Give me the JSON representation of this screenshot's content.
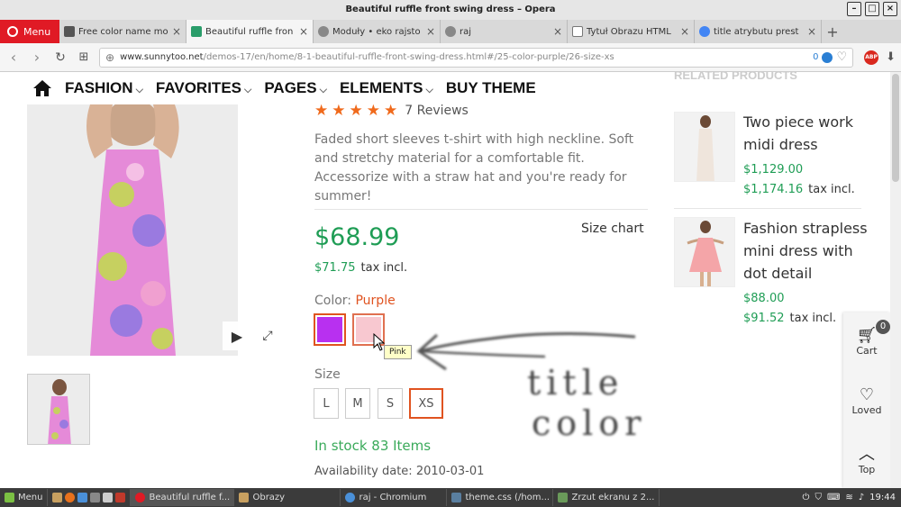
{
  "window": {
    "title": "Beautiful ruffle front swing dress – Opera"
  },
  "browser": {
    "menu_label": "Menu",
    "tabs": [
      {
        "title": "Free color name mo"
      },
      {
        "title": "Beautiful ruffle fron"
      },
      {
        "title": "Moduły • eko rajsto"
      },
      {
        "title": "raj"
      },
      {
        "title": "Tytuł Obrazu HTML"
      },
      {
        "title": "title atrybutu prest"
      }
    ],
    "url_domain": "www.sunnytoo.net",
    "url_path": "/demos-17/en/home/8-1-beautiful-ruffle-front-swing-dress.html#/25-color-purple/26-size-xs",
    "adblock_count": "0",
    "abp_label": "ABP"
  },
  "nav": {
    "items": [
      {
        "label": "FASHION",
        "dropdown": true
      },
      {
        "label": "FAVORITES",
        "dropdown": true
      },
      {
        "label": "PAGES",
        "dropdown": true
      },
      {
        "label": "ELEMENTS",
        "dropdown": true
      },
      {
        "label": "BUY THEME",
        "dropdown": false
      }
    ]
  },
  "product": {
    "rating": 5,
    "reviews": "7 Reviews",
    "description": "Faded short sleeves t-shirt with high neckline. Soft and stretchy material for a comfortable fit. Accessorize with a straw hat and you're ready for summer!",
    "price": "$68.99",
    "price_tax": "$71.75",
    "tax_label": "tax incl.",
    "size_chart": "Size chart",
    "color_label": "Color:",
    "color_value": "Purple",
    "colors": [
      {
        "name": "Purple",
        "hex": "#b830f0"
      },
      {
        "name": "Pink",
        "hex": "#f8c8d0"
      }
    ],
    "tooltip": "Pink",
    "size_label": "Size",
    "sizes": [
      "L",
      "M",
      "S",
      "XS"
    ],
    "selected_size": "XS",
    "stock": "In stock 83 Items",
    "availability": "Availability date: 2010-03-01"
  },
  "related": {
    "heading": "RELATED PRODUCTS",
    "items": [
      {
        "title": "Two piece work midi dress",
        "price": "$1,129.00",
        "price_tax": "$1,174.16",
        "tax_label": "tax incl."
      },
      {
        "title": "Fashion strapless mini dress with dot detail",
        "price": "$88.00",
        "price_tax": "$91.52",
        "tax_label": "tax incl."
      }
    ]
  },
  "sidebar": {
    "cart_label": "Cart",
    "cart_count": "0",
    "loved_label": "Loved",
    "top_label": "Top"
  },
  "annotation": {
    "text_line1": "title",
    "text_line2": "color"
  },
  "taskbar": {
    "menu_label": "Menu",
    "windows": [
      {
        "title": "Beautiful ruffle f..."
      },
      {
        "title": "Obrazy"
      },
      {
        "title": "raj - Chromium"
      },
      {
        "title": "theme.css (/hom..."
      },
      {
        "title": "Zrzut ekranu z 2..."
      }
    ],
    "clock": "19:44"
  },
  "colors": {
    "accent": "#e05320",
    "price_green": "#1f9d55",
    "stock_green": "#3aaa5a",
    "star": "#f06a1c",
    "opera_red": "#e01a25"
  }
}
